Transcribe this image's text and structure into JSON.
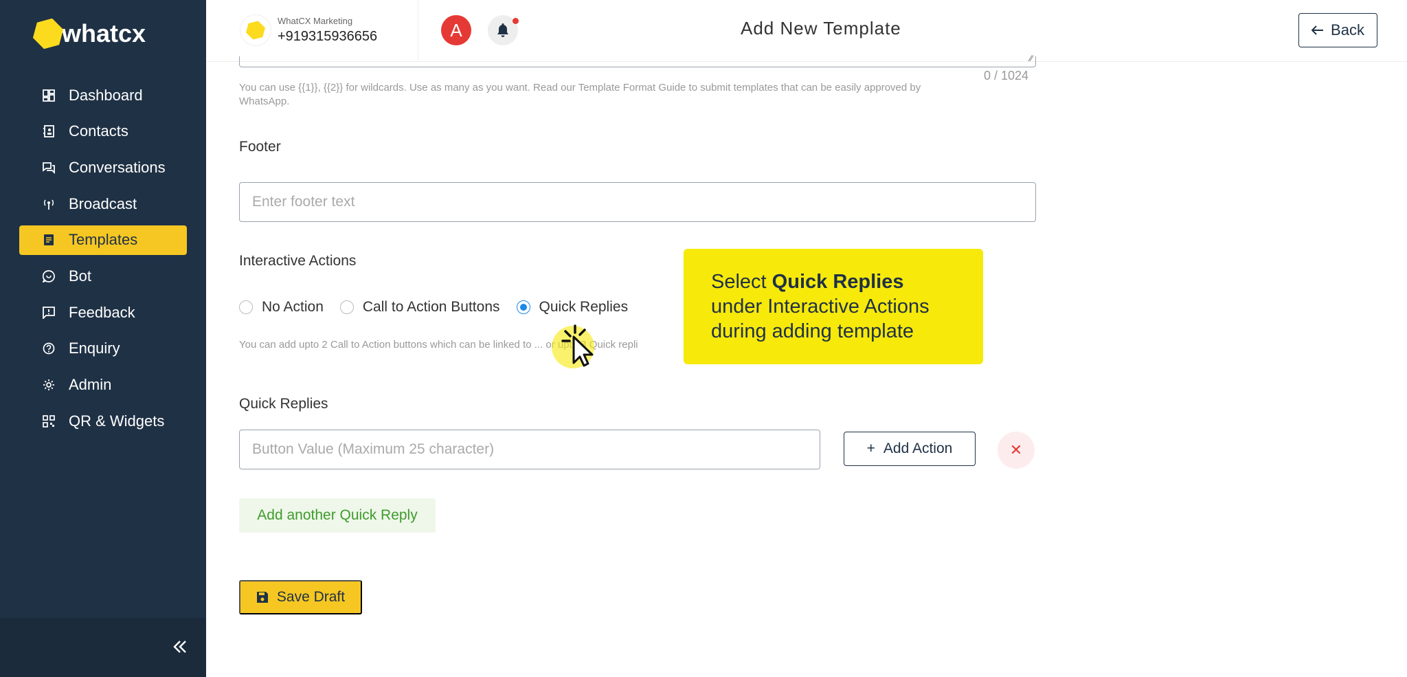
{
  "brand": {
    "logo_text": "whatcx",
    "accent": "#f6c723",
    "sidebar_bg": "#1f3145"
  },
  "sidebar": {
    "items": [
      {
        "label": "Dashboard",
        "icon": "dashboard-icon"
      },
      {
        "label": "Contacts",
        "icon": "contacts-icon"
      },
      {
        "label": "Conversations",
        "icon": "conversations-icon"
      },
      {
        "label": "Broadcast",
        "icon": "broadcast-icon"
      },
      {
        "label": "Templates",
        "icon": "templates-icon",
        "active": true
      },
      {
        "label": "Bot",
        "icon": "bot-icon"
      },
      {
        "label": "Feedback",
        "icon": "feedback-icon"
      },
      {
        "label": "Enquiry",
        "icon": "enquiry-icon"
      },
      {
        "label": "Admin",
        "icon": "admin-icon"
      },
      {
        "label": "QR & Widgets",
        "icon": "qr-icon"
      }
    ],
    "collapse_icon": "double-chevron-left-icon"
  },
  "header": {
    "account_name": "WhatCX Marketing",
    "account_phone": "+919315936656",
    "avatar_letter": "A",
    "title": "Add New Template",
    "back_label": "Back"
  },
  "form": {
    "body_counter": "0 / 1024",
    "body_hint": "You can use {{1}}, {{2}} for wildcards. Use as many as you want. Read our Template Format Guide to submit templates that can be easily approved by WhatsApp.",
    "footer_label": "Footer",
    "footer_placeholder": "Enter footer text",
    "interactive_label": "Interactive Actions",
    "radio_options": [
      "No Action",
      "Call to Action Buttons",
      "Quick Replies"
    ],
    "selected_option": "Quick Replies",
    "interactive_hint": "You can add upto 2 Call to Action buttons which can be linked to ... or upto 3 Quick repli",
    "quick_replies_label": "Quick Replies",
    "quick_reply_placeholder": "Button Value (Maximum 25 character)",
    "add_action_label": "Add Action",
    "add_quick_reply_label": "Add another Quick Reply",
    "save_draft_label": "Save Draft"
  },
  "tooltip": {
    "prefix": "Select ",
    "bold": "Quick Replies",
    "rest": "under Interactive Actions during adding template"
  }
}
